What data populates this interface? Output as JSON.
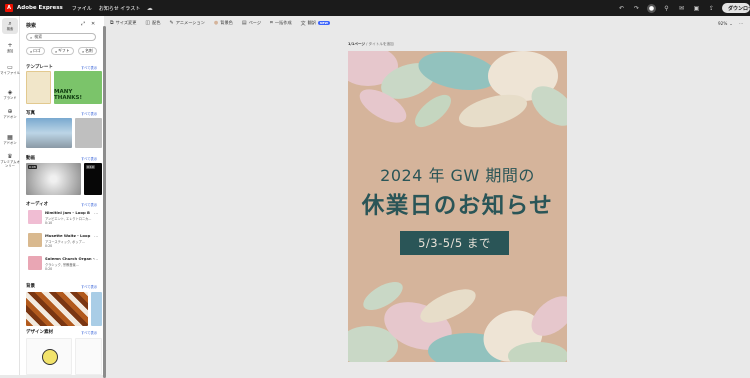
{
  "topbar": {
    "app_name": "Adobe Express",
    "menu": [
      "ファイル",
      "お知らせ イラスト"
    ],
    "download_label": "ダウンロード"
  },
  "rail": {
    "items": [
      {
        "label": "検索",
        "icon": "search-icon"
      },
      {
        "label": "追加",
        "icon": "plus-icon"
      },
      {
        "label": "マイファイル",
        "icon": "folder-icon"
      },
      {
        "label": "ブランド",
        "icon": "brand-icon"
      },
      {
        "label": "アドオン",
        "icon": "addons-icon"
      },
      {
        "label": "アドオン",
        "icon": "apps-icon"
      },
      {
        "label": "プレミアムオンリー",
        "icon": "crown-icon"
      }
    ]
  },
  "panel": {
    "title": "検索",
    "search_placeholder": "検索",
    "chips": [
      "ロゴ",
      "ギフト",
      "名刺"
    ],
    "sections": {
      "templates": {
        "title": "テンプレート",
        "more": "すべて表示",
        "thumb_text": "MANY THANKS!"
      },
      "photos": {
        "title": "写真",
        "more": "すべて表示"
      },
      "videos": {
        "title": "動画",
        "more": "すべて表示",
        "badge1": "0:08",
        "badge2": "0:10"
      },
      "audio": {
        "title": "オーディオ",
        "more": "すべて表示",
        "tracks": [
          {
            "title": "Nimitini Jam - Loop B",
            "subtitle": "アンビエント, エレクトロニカ...",
            "duration": "0:10"
          },
          {
            "title": "Musette Waltz - Loop",
            "subtitle": "アコースティック, ポップ...",
            "duration": "0:20"
          },
          {
            "title": "Solemn Church Organ -",
            "subtitle": "クラシック, 宗教音楽...",
            "duration": "0:20"
          }
        ]
      },
      "backgrounds": {
        "title": "背景",
        "more": "すべて表示"
      },
      "design_assets": {
        "title": "デザイン素材",
        "more": "すべて表示"
      }
    }
  },
  "toolbar": {
    "items": [
      "サイズ変更",
      "配色",
      "アニメーション",
      "背景色",
      "ページ",
      "一括作成",
      "翻訳"
    ],
    "new_badge": "NEW",
    "zoom": "92%"
  },
  "canvas": {
    "page_label": "1/1ページ",
    "page_title": "タイトルを追加"
  },
  "poster": {
    "line1": "2024 年 GW 期間の",
    "line2": "休業日のお知らせ",
    "dates": "5/3-5/5 まで",
    "colors": {
      "background": "#d5b49b",
      "text": "#2a5557",
      "box": "#2a5557"
    }
  }
}
